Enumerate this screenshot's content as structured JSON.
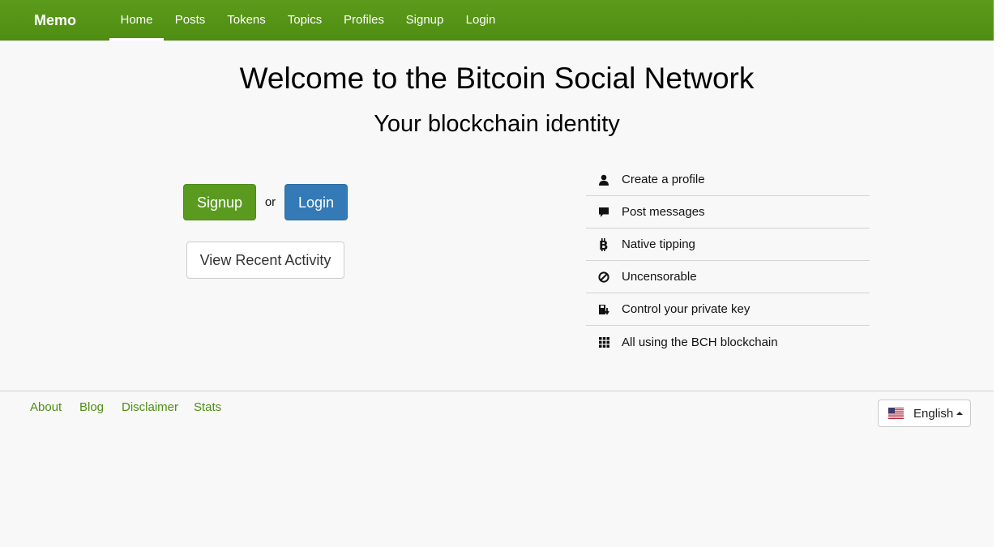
{
  "nav": {
    "brand": "Memo",
    "items": [
      {
        "label": "Home",
        "active": true
      },
      {
        "label": "Posts"
      },
      {
        "label": "Tokens"
      },
      {
        "label": "Topics"
      },
      {
        "label": "Profiles"
      },
      {
        "label": "Signup"
      },
      {
        "label": "Login"
      }
    ]
  },
  "hero": {
    "title": "Welcome to the Bitcoin Social Network",
    "subtitle": "Your blockchain identity"
  },
  "actions": {
    "signup": "Signup",
    "or": "or",
    "login": "Login",
    "recent": "View Recent Activity"
  },
  "features": [
    {
      "icon": "user-icon",
      "label": "Create a profile"
    },
    {
      "icon": "comment-icon",
      "label": "Post messages"
    },
    {
      "icon": "bitcoin-icon",
      "label": "Native tipping"
    },
    {
      "icon": "ban-icon",
      "label": "Uncensorable"
    },
    {
      "icon": "save-icon",
      "label": "Control your private key"
    },
    {
      "icon": "grid-icon",
      "label": "All using the BCH blockchain"
    }
  ],
  "footer": {
    "links": [
      "About",
      "Blog",
      "Disclaimer",
      "Stats"
    ],
    "language": "English"
  },
  "colors": {
    "nav_bg": "#5c9a1b",
    "signup_btn": "#5a9b1f",
    "login_btn": "#337ab7",
    "footer_link": "#4e8d14"
  }
}
